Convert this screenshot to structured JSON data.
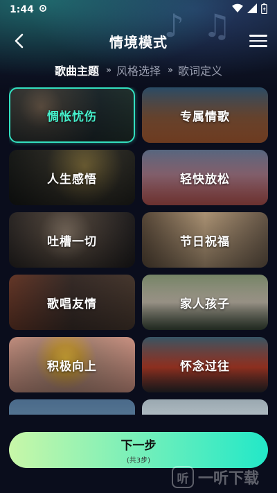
{
  "status_bar": {
    "time": "1:44"
  },
  "header": {
    "title": "情境模式"
  },
  "steps": [
    {
      "label": "歌曲主题",
      "active": true
    },
    {
      "label": "风格选择",
      "active": false
    },
    {
      "label": "歌词定义",
      "active": false
    }
  ],
  "step_separator": "»",
  "cards": [
    {
      "label": "惆怅忧伤",
      "selected": true
    },
    {
      "label": "专属情歌",
      "selected": false
    },
    {
      "label": "人生感悟",
      "selected": false
    },
    {
      "label": "轻快放松",
      "selected": false
    },
    {
      "label": "吐槽一切",
      "selected": false
    },
    {
      "label": "节日祝福",
      "selected": false
    },
    {
      "label": "歌唱友情",
      "selected": false
    },
    {
      "label": "家人孩子",
      "selected": false
    },
    {
      "label": "积极向上",
      "selected": false
    },
    {
      "label": "怀念过往",
      "selected": false
    }
  ],
  "next_button": {
    "label": "下一步",
    "sublabel": "(共3步)"
  },
  "watermark": {
    "logo_text": "听",
    "text": "一听下载"
  },
  "colors": {
    "accent_selected": "#33e0c0",
    "button_gradient_start": "#c8f7a8",
    "button_gradient_end": "#22e8c8",
    "background": "#0a0d1c"
  }
}
